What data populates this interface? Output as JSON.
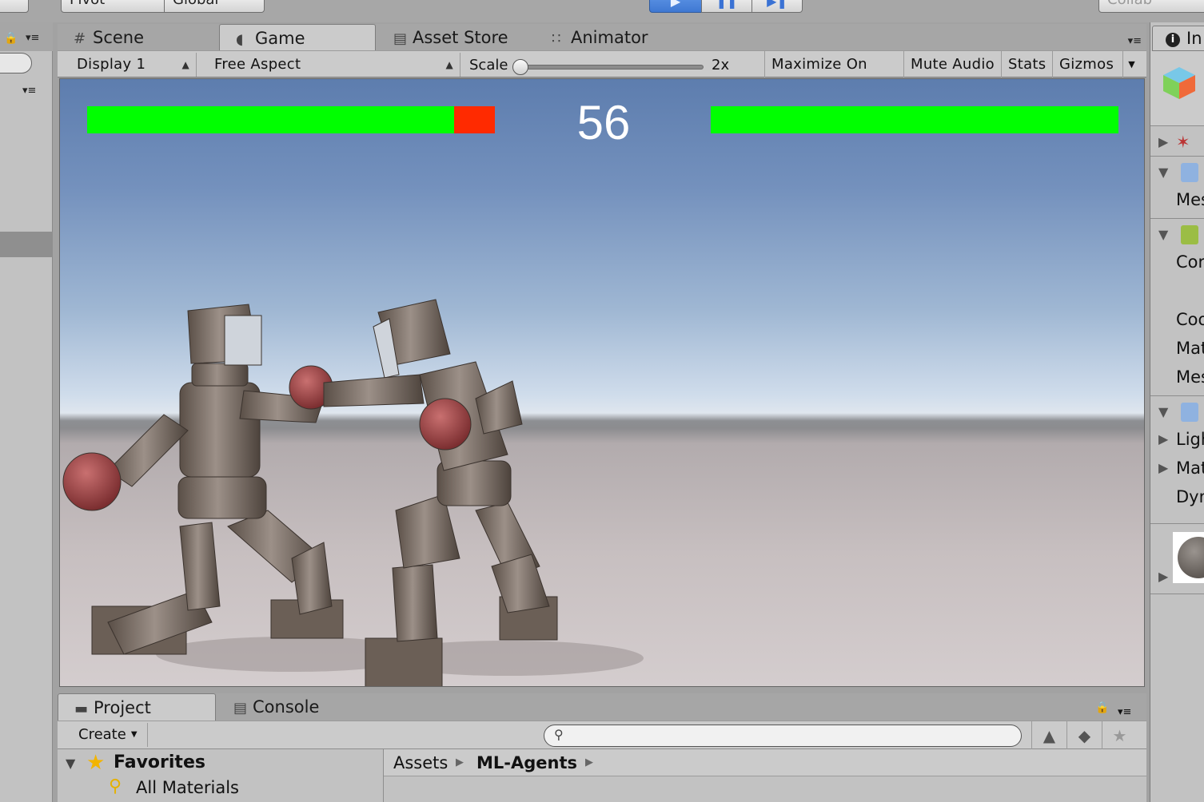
{
  "toolbar": {
    "pivot_label": "Pivot",
    "global_label": "Global",
    "collab_label": "Collab",
    "play_icon": "play-icon",
    "pause_icon": "pause-icon",
    "step_icon": "step-icon"
  },
  "editor_tabs": [
    {
      "label": "Scene",
      "icon": "scene-icon"
    },
    {
      "label": "Game",
      "icon": "game-icon"
    },
    {
      "label": "Asset Store",
      "icon": "store-icon"
    },
    {
      "label": "Animator",
      "icon": "animator-icon"
    }
  ],
  "game_toolbar": {
    "display": "Display 1",
    "aspect": "Free Aspect",
    "scale_label": "Scale",
    "scale_value": "2x",
    "scale_fraction": 0.0,
    "maximize_label": "Maximize On Play",
    "mute_label": "Mute Audio",
    "stats_label": "Stats",
    "gizmos_label": "Gizmos"
  },
  "game_view": {
    "timer": "56",
    "left_health": 0.9,
    "right_health": 1.0,
    "health_color": "#00ff00",
    "damage_color": "#ff2a00"
  },
  "project_tabs": [
    {
      "label": "Project",
      "icon": "folder-icon"
    },
    {
      "label": "Console",
      "icon": "console-icon"
    }
  ],
  "project": {
    "create_label": "Create",
    "search_placeholder": "",
    "favorites_label": "Favorites",
    "favorites_items": [
      "All Materials"
    ],
    "breadcrumb": [
      "Assets",
      "ML-Agents"
    ]
  },
  "inspector": {
    "tab_label": "In",
    "rows": [
      "Mes",
      "Cor",
      "Coo",
      "Mat",
      "Mes",
      "Ligh",
      "Mat",
      "Dyn"
    ]
  },
  "colors": {
    "play_accent": "#3f78d2",
    "favorites_star": "#f2b400"
  }
}
